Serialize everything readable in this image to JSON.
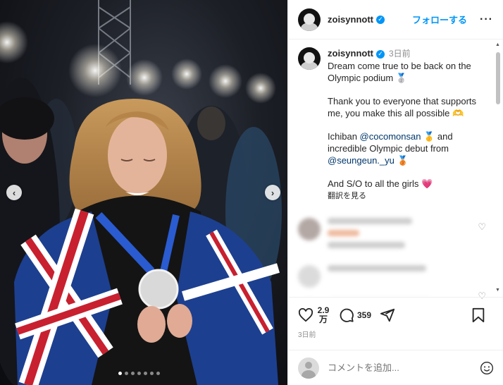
{
  "post": {
    "username": "zoisynnott",
    "verified_mark": "✓",
    "follow_label": "フォローする",
    "more_label": "···",
    "carousel": {
      "prev_icon": "‹",
      "next_icon": "›",
      "dots": 7,
      "active_dot": 0
    }
  },
  "caption": {
    "username": "zoisynnott",
    "time": "3日前",
    "line1": "Dream come true to be back on the",
    "line2": "Olympic podium 🥈",
    "line3": "Thank you to everyone that supports",
    "line4": "me, you make this all possible 🫶",
    "line5_pre": "Ichiban ",
    "line5_mention": "@cocomonsan",
    "line5_post": " 🥇 and",
    "line6": "incredible Olympic debut from",
    "line7_mention": "@seungeun._yu",
    "line7_post": " 🥉",
    "line8": "And S/O to all the girls 💗",
    "translate": "翻訳を見る"
  },
  "actions": {
    "likes_top": "2.9",
    "likes_bottom": "万",
    "comments": "359",
    "posted_time": "3日前"
  },
  "comment_box": {
    "placeholder": "コメントを追加..."
  },
  "colors": {
    "accent": "#0095f6",
    "mention": "#00376b",
    "muted": "#8e8e8e"
  }
}
